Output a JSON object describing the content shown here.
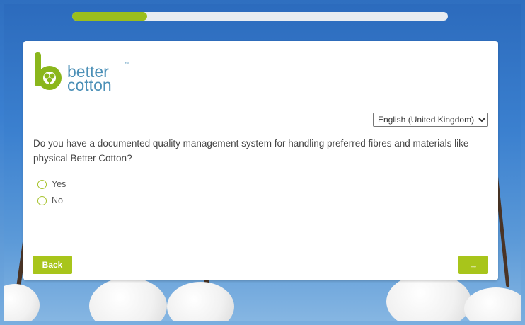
{
  "progress": {
    "fraction": 0.2
  },
  "brand": {
    "line1": "better",
    "line2": "cotton",
    "tm": "™",
    "logo_color": "#8ab61c"
  },
  "language": {
    "selected": "English (United Kingdom)"
  },
  "question": {
    "text": "Do you have a documented quality management system for handling preferred fibres and materials like physical Better Cotton?"
  },
  "options": [
    {
      "label": "Yes"
    },
    {
      "label": "No"
    }
  ],
  "nav": {
    "back_label": "Back",
    "next_label": "→"
  },
  "colors": {
    "accent": "#a8c51b",
    "progress": "#9bbe1c"
  }
}
